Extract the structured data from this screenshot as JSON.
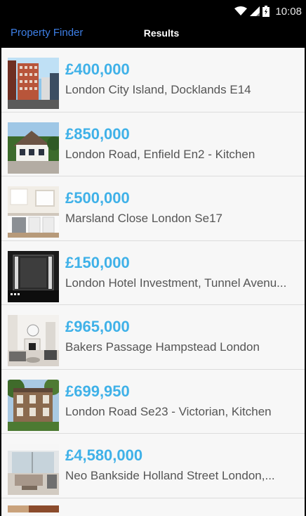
{
  "status_bar": {
    "time": "10:08",
    "icons": [
      "wifi-icon",
      "signal-icon",
      "battery-icon"
    ]
  },
  "nav": {
    "back_label": "Property Finder",
    "title": "Results"
  },
  "colors": {
    "price": "#3fb1e8",
    "back_link": "#3d7fe6",
    "background": "#f7f7f7"
  },
  "listings": [
    {
      "price": "£400,000",
      "address": "London City Island, Docklands E14",
      "thumb": "tower-block-photo"
    },
    {
      "price": "£850,000",
      "address": "London Road, Enfield En2 - Kitchen",
      "thumb": "detached-house-photo"
    },
    {
      "price": "£500,000",
      "address": "Marsland Close London Se17",
      "thumb": "kitchen-photo"
    },
    {
      "price": "£150,000",
      "address": "London Hotel Investment, Tunnel Avenu...",
      "thumb": "hotel-room-photo"
    },
    {
      "price": "£965,000",
      "address": "Bakers Passage Hampstead London",
      "thumb": "living-room-photo"
    },
    {
      "price": "£699,950",
      "address": "London Road Se23 - Victorian, Kitchen",
      "thumb": "victorian-house-photo"
    },
    {
      "price": "£4,580,000",
      "address": "Neo Bankside Holland Street London,...",
      "thumb": "lounge-photo"
    }
  ]
}
